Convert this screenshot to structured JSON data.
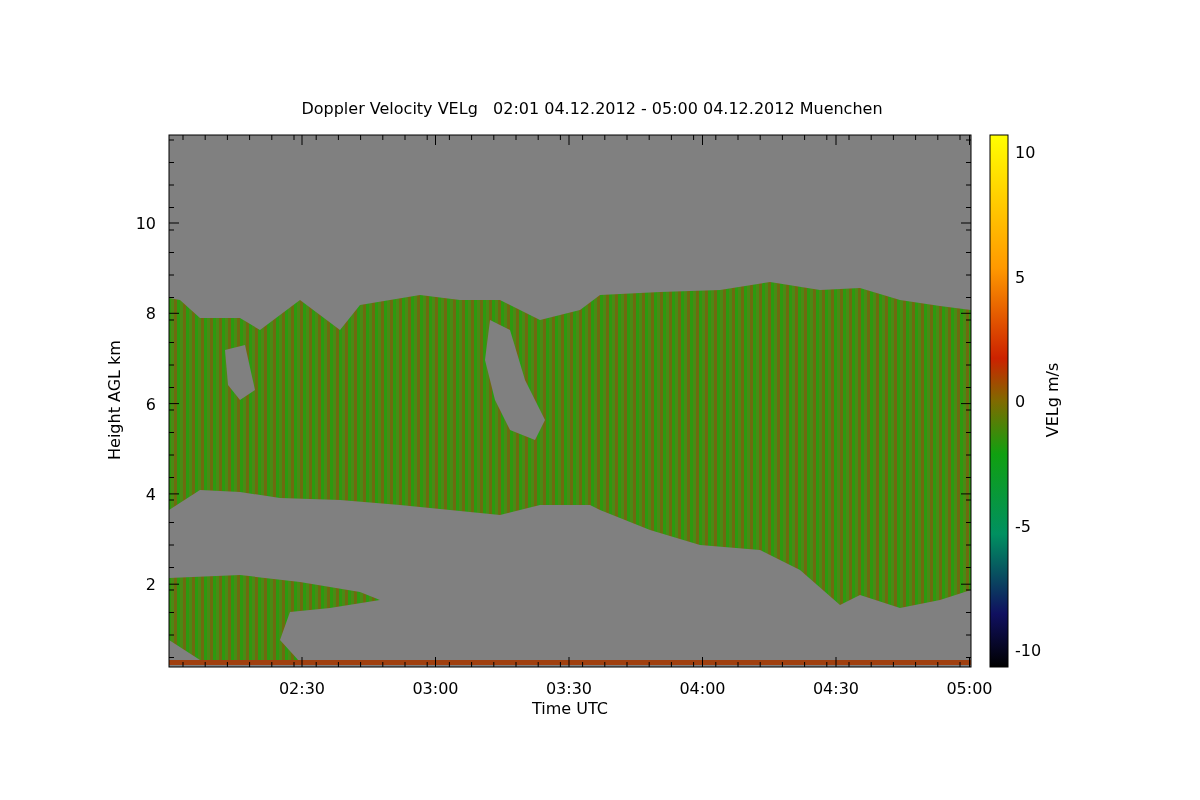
{
  "title": "Doppler Velocity VELg   02:01 04.12.2012 - 05:00 04.12.2012 Muenchen",
  "x_axis": {
    "label": "Time UTC",
    "ticks": [
      "02:30",
      "03:00",
      "03:30",
      "04:00",
      "04:30",
      "05:00"
    ]
  },
  "y_axis": {
    "label": "Height AGL km",
    "ticks": [
      "10",
      "8",
      "6",
      "4",
      "2"
    ]
  },
  "colorbar": {
    "label": "VELg m/s",
    "ticks": [
      "10",
      "5",
      "0",
      "-5",
      "-10"
    ]
  }
}
